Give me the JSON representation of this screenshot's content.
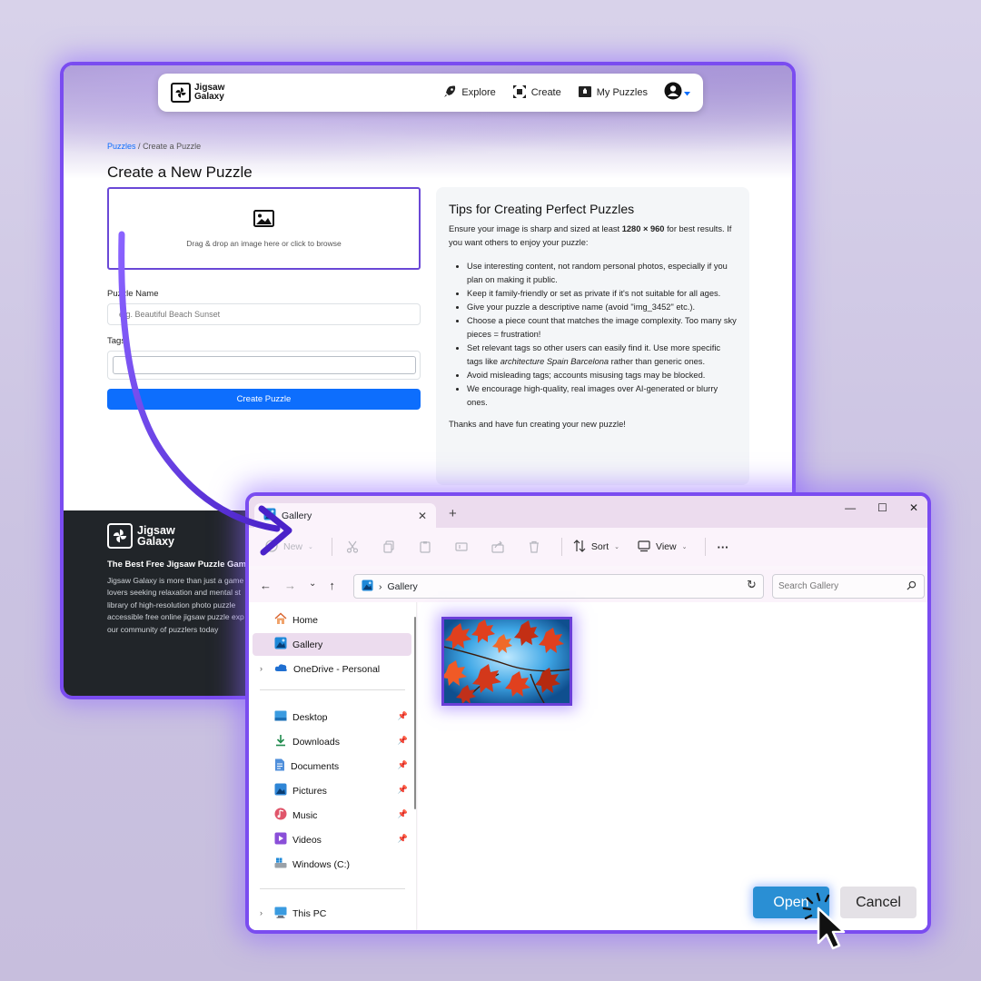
{
  "colors": {
    "accent": "#7a4cf0",
    "primary": "#0d6efd",
    "footer_bg": "#212529",
    "explorer_selection": "#ecdcee",
    "open_button": "#2a8fd4"
  },
  "web": {
    "logo": {
      "line1": "Jigsaw",
      "line2": "Galaxy"
    },
    "nav": {
      "explore": "Explore",
      "create": "Create",
      "my_puzzles": "My Puzzles"
    },
    "breadcrumb": {
      "root": "Puzzles",
      "separator": "/",
      "current": "Create a Puzzle"
    },
    "page_title": "Create a New Puzzle",
    "dropzone_text": "Drag & drop an image here or click to browse",
    "puzzle_name_label": "Puzzle Name",
    "puzzle_name_placeholder": "e.g. Beautiful Beach Sunset",
    "tags_label": "Tags",
    "create_button": "Create Puzzle",
    "tips": {
      "title": "Tips for Creating Perfect Puzzles",
      "intro_before": "Ensure your image is sharp and sized at least ",
      "intro_size": "1280 × 960",
      "intro_after": " for best results. If you want others to enjoy your puzzle:",
      "item1": "Use interesting content, not random personal photos, especially if you plan on making it public.",
      "item2": "Keep it family-friendly or set as private if it's not suitable for all ages.",
      "item3": "Give your puzzle a descriptive name (avoid \"img_3452\" etc.).",
      "item4": "Choose a piece count that matches the image complexity. Too many sky pieces = frustration!",
      "item5_before": "Set relevant tags so other users can easily find it. Use more specific tags like ",
      "item5_tags": "architecture Spain Barcelona",
      "item5_after": " rather than generic ones.",
      "item6": "Avoid misleading tags; accounts misusing tags may be blocked.",
      "item7": "We encourage high-quality, real images over AI-generated or blurry ones.",
      "outro": "Thanks and have fun creating your new puzzle!"
    },
    "footer": {
      "logo_line1": "Jigsaw",
      "logo_line2": "Galaxy",
      "tagline": "The Best Free Jigsaw Puzzle Gam",
      "description_lines": [
        "Jigsaw Galaxy is more than just a game",
        "lovers seeking relaxation and mental st",
        "library of high-resolution photo puzzle",
        "accessible free online jigsaw puzzle exp",
        "our community of puzzlers today"
      ]
    }
  },
  "explorer": {
    "tab_title": "Gallery",
    "tab_close": "✕",
    "new_tab": "+",
    "window_controls": {
      "minimize": "—",
      "maximize": "☐",
      "close": "✕"
    },
    "toolbar": {
      "new_label": "New",
      "sort_label": "Sort",
      "view_label": "View",
      "more_label": "···"
    },
    "address": {
      "separator": "›",
      "location": "Gallery"
    },
    "search_placeholder": "Search Gallery",
    "nav": {
      "home": "Home",
      "gallery": "Gallery",
      "onedrive": "OneDrive - Personal",
      "desktop": "Desktop",
      "downloads": "Downloads",
      "documents": "Documents",
      "pictures": "Pictures",
      "music": "Music",
      "videos": "Videos",
      "windows_c": "Windows (C:)",
      "this_pc": "This PC"
    },
    "open_button": "Open",
    "cancel_button": "Cancel"
  }
}
